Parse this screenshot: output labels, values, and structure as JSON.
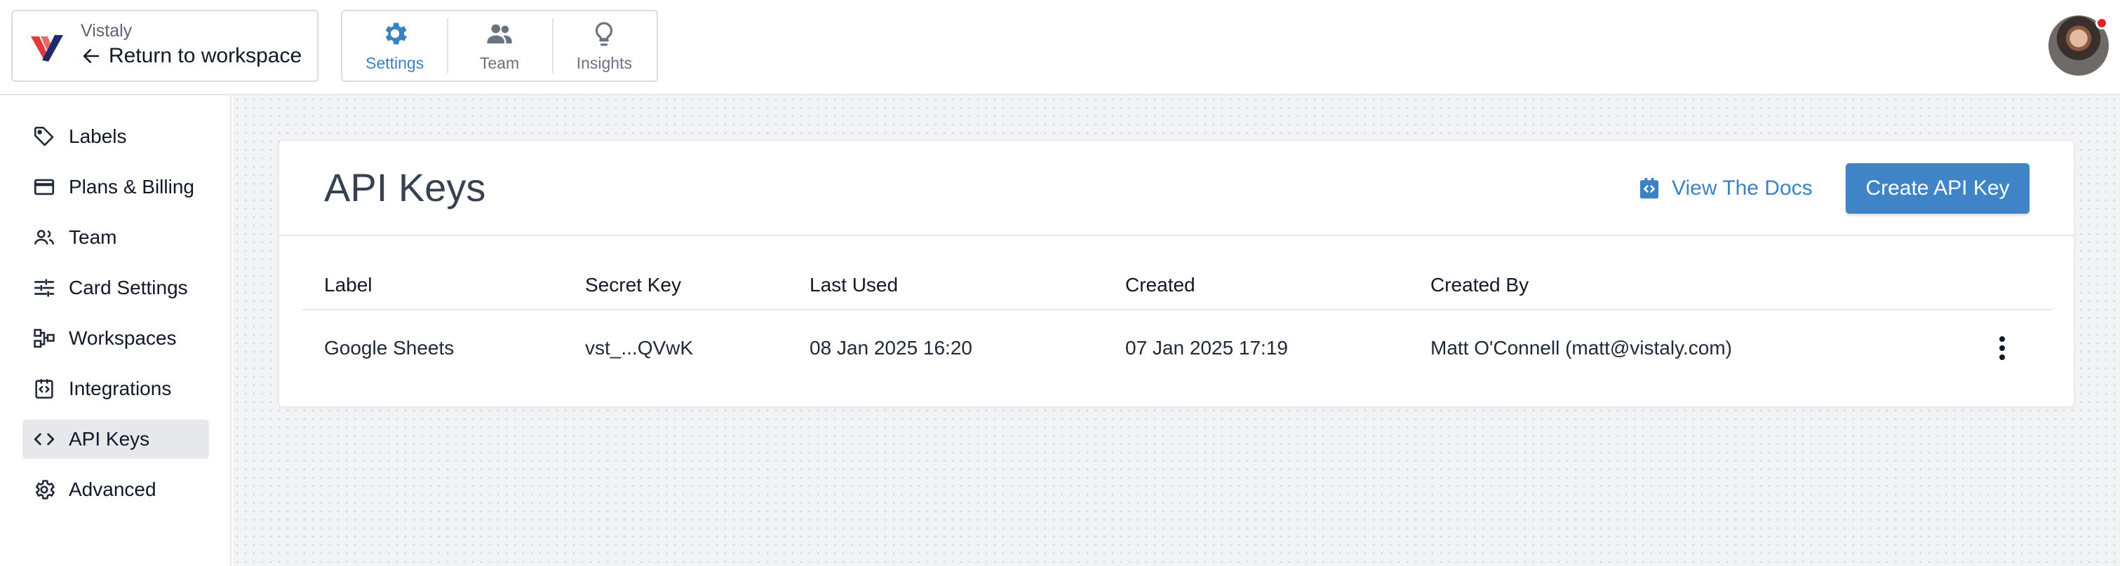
{
  "brand": {
    "name": "Vistaly",
    "back_label": "Return to workspace"
  },
  "nav": {
    "tabs": [
      {
        "label": "Settings",
        "icon": "gear-icon",
        "active": true
      },
      {
        "label": "Team",
        "icon": "people-icon",
        "active": false
      },
      {
        "label": "Insights",
        "icon": "lightbulb-icon",
        "active": false
      }
    ]
  },
  "user": {
    "avatar": "user-avatar",
    "notification": true
  },
  "sidebar": {
    "items": [
      {
        "label": "Labels",
        "icon": "tag-icon"
      },
      {
        "label": "Plans & Billing",
        "icon": "credit-card-icon"
      },
      {
        "label": "Team",
        "icon": "people-icon"
      },
      {
        "label": "Card Settings",
        "icon": "sliders-icon"
      },
      {
        "label": "Workspaces",
        "icon": "workspaces-icon"
      },
      {
        "label": "Integrations",
        "icon": "integration-icon"
      },
      {
        "label": "API Keys",
        "icon": "code-icon",
        "active": true
      },
      {
        "label": "Advanced",
        "icon": "gear-icon"
      }
    ]
  },
  "page": {
    "title": "API Keys",
    "docs_label": "View The Docs",
    "create_label": "Create API Key"
  },
  "table": {
    "columns": [
      "Label",
      "Secret Key",
      "Last Used",
      "Created",
      "Created By"
    ],
    "rows": [
      [
        "Google Sheets",
        "vst_...QVwK",
        "08 Jan 2025 16:20",
        "07 Jan 2025 17:19",
        "Matt O'Connell (matt@vistaly.com)"
      ]
    ]
  },
  "colors": {
    "accent": "#3f84c6",
    "link": "#3b82c4",
    "active_sidebar_bg": "#e6e8ec",
    "logo_red": "#e23a3a",
    "logo_navy": "#1f2a6b"
  }
}
